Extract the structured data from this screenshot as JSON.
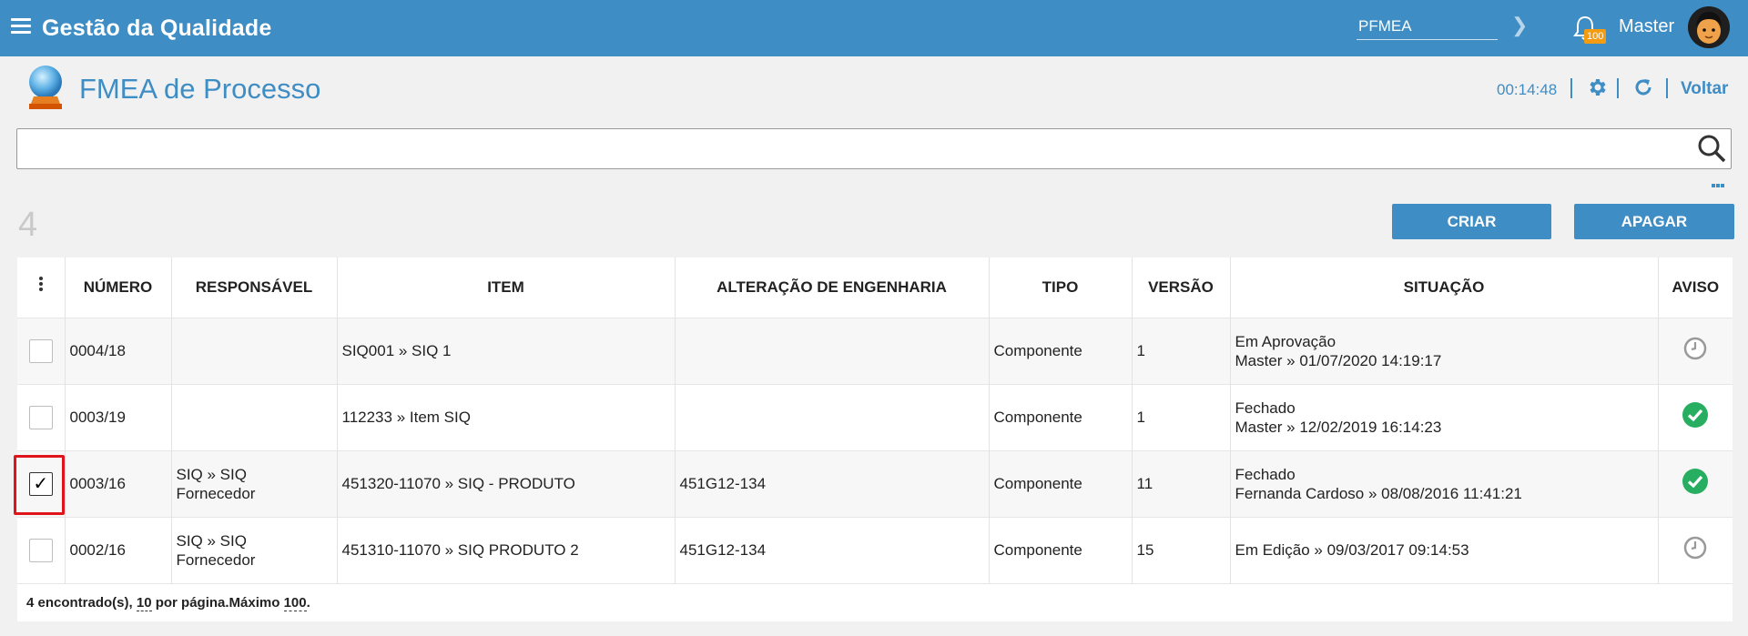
{
  "topbar": {
    "app_title": "Gestão da Qualidade",
    "module_value": "PFMEA",
    "notification_count": "100",
    "username": "Master"
  },
  "page": {
    "title": "FMEA de Processo",
    "timer": "00:14:48",
    "back_label": "Voltar"
  },
  "search": {
    "value": "",
    "placeholder": ""
  },
  "results_count": "4",
  "actions": {
    "create_label": "CRIAR",
    "delete_label": "APAGAR"
  },
  "table": {
    "columns": [
      "NÚMERO",
      "RESPONSÁVEL",
      "ITEM",
      "ALTERAÇÃO DE ENGENHARIA",
      "TIPO",
      "VERSÃO",
      "SITUAÇÃO",
      "AVISO"
    ],
    "rows": [
      {
        "numero": "0004/18",
        "responsavel_1": "",
        "responsavel_2": "",
        "item": "SIQ001 » SIQ 1",
        "alteracao": "",
        "tipo": "Componente",
        "versao": "1",
        "situacao_1": "Em Aprovação",
        "situacao_2": "Master » 01/07/2020 14:19:17",
        "aviso": "clock-icon",
        "checked": false
      },
      {
        "numero": "0003/19",
        "responsavel_1": "",
        "responsavel_2": "",
        "item": "112233 » Item SIQ",
        "alteracao": "",
        "tipo": "Componente",
        "versao": "1",
        "situacao_1": "Fechado",
        "situacao_2": "Master » 12/02/2019 16:14:23",
        "aviso": "check-circle-icon",
        "checked": false
      },
      {
        "numero": "0003/16",
        "responsavel_1": "SIQ » SIQ",
        "responsavel_2": "Fornecedor",
        "item": "451320-11070 » SIQ - PRODUTO",
        "alteracao": "451G12-134",
        "tipo": "Componente",
        "versao": "11",
        "situacao_1": "Fechado",
        "situacao_2": "Fernanda Cardoso » 08/08/2016 11:41:21",
        "aviso": "check-circle-icon",
        "checked": true
      },
      {
        "numero": "0002/16",
        "responsavel_1": "SIQ » SIQ",
        "responsavel_2": "Fornecedor",
        "item": "451310-11070 » SIQ PRODUTO 2",
        "alteracao": "451G12-134",
        "tipo": "Componente",
        "versao": "15",
        "situacao_1": "Em Edição » 09/03/2017 09:14:53",
        "situacao_2": "",
        "aviso": "clock-icon",
        "checked": false
      }
    ]
  },
  "footer": {
    "found_text": "4 encontrado(s), ",
    "per_page": "10",
    "per_page_text": " por página.Máximo ",
    "max": "100",
    "end": "."
  },
  "colors": {
    "primary": "#3e8dc5",
    "success": "#27ae60",
    "badge": "#f39c12",
    "highlight": "#e0151b"
  }
}
